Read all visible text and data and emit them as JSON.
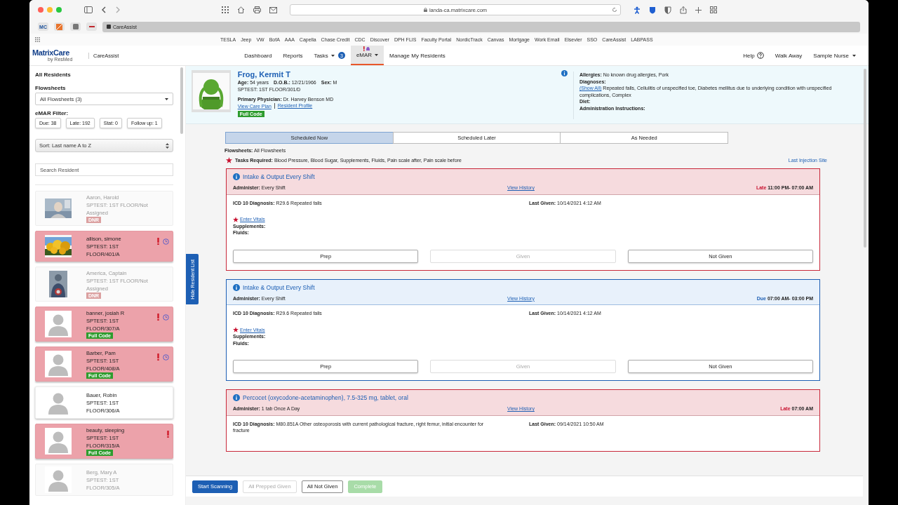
{
  "browser": {
    "url": "landa-ca.matrixcare.com",
    "pinned_tabs": [
      "MC"
    ],
    "tab_title": "CareAssist",
    "bookmarks": [
      "TESLA",
      "Jeep",
      "VW",
      "BofA",
      "AAA",
      "Capella",
      "Chase Credit",
      "CDC",
      "Discover",
      "DPH FLIS",
      "Faculty Portal",
      "NordicTrack",
      "Canvas",
      "Mortgage",
      "Work Email",
      "Elsevier",
      "SSO",
      "CareAssist",
      "LABPASS"
    ]
  },
  "app": {
    "brand": "MatrixCare",
    "brand_sub": "by ResMed",
    "product": "CareAssist",
    "nav": [
      {
        "label": "Dashboard",
        "selected": false,
        "dropdown": false,
        "alert": false
      },
      {
        "label": "Reports",
        "selected": false,
        "dropdown": false,
        "alert": false
      },
      {
        "label": "Tasks",
        "selected": false,
        "dropdown": true,
        "alert": false,
        "badge": "3"
      },
      {
        "label": "eMAR",
        "selected": true,
        "dropdown": true,
        "alert": true
      },
      {
        "label": "Manage My Residents",
        "selected": false,
        "dropdown": false,
        "alert": false
      }
    ],
    "help": "Help",
    "walk_away": "Walk Away",
    "user": "Sample Nurse"
  },
  "sidebar": {
    "title": "All Residents",
    "flowsheets_label": "Flowsheets",
    "flowsheets_value": "All Flowsheets (3)",
    "filter_label": "eMAR Filter:",
    "filters": [
      "Due: 38",
      "Late: 192",
      "Stat: 0",
      "Follow up: 1"
    ],
    "sort_value": "Sort: Last name A to Z",
    "search_placeholder": "Search Resident",
    "residents": [
      {
        "name": "Aaron, Harold",
        "location": "SPTEST: 1ST FLOOR/Not Assigned",
        "code": {
          "label": "DNR",
          "kind": "dnr"
        },
        "late": false,
        "dimmed": true,
        "avatar": {
          "kind": "portrait"
        },
        "alert": false,
        "clock": false
      },
      {
        "name": "allison, simone",
        "location": "SPTEST: 1ST FLOOR/401/A",
        "late": true,
        "dimmed": false,
        "avatar": {
          "kind": "flowers"
        },
        "alert": true,
        "clock": true
      },
      {
        "name": "America, Captain",
        "location": "SPTEST: 1ST FLOOR/Not Assigned",
        "code": {
          "label": "DNR",
          "kind": "dnr"
        },
        "late": false,
        "dimmed": true,
        "avatar": {
          "kind": "figure"
        },
        "alert": false,
        "clock": false
      },
      {
        "name": "banner, josiah R",
        "location": "SPTEST: 1ST FLOOR/307/A",
        "code": {
          "label": "Full Code",
          "kind": "full"
        },
        "late": true,
        "dimmed": false,
        "avatar": {
          "kind": "silhouette"
        },
        "alert": true,
        "clock": true
      },
      {
        "name": "Barber, Pam",
        "location": "SPTEST: 1ST FLOOR/408/A",
        "code": {
          "label": "Full Code",
          "kind": "full"
        },
        "late": true,
        "dimmed": false,
        "avatar": {
          "kind": "silhouette"
        },
        "alert": true,
        "clock": true
      },
      {
        "name": "Bauer, Robin",
        "location": "SPTEST: 1ST FLOOR/306/A",
        "late": false,
        "dimmed": false,
        "avatar": {
          "kind": "silhouette"
        },
        "alert": false,
        "clock": false
      },
      {
        "name": "beauty, sleeping",
        "location": "SPTEST: 1ST FLOOR/315/A",
        "code": {
          "label": "Full Code",
          "kind": "full"
        },
        "late": true,
        "dimmed": false,
        "avatar": {
          "kind": "silhouette"
        },
        "alert": true,
        "clock": false
      },
      {
        "name": "Berg, Mary A",
        "location": "SPTEST: 1ST FLOOR/305/A",
        "late": false,
        "dimmed": true,
        "avatar": {
          "kind": "silhouette"
        },
        "alert": false,
        "clock": false
      }
    ]
  },
  "hide_list": "Hide Resident List",
  "resident": {
    "name": "Frog, Kermit T",
    "demographics": [
      {
        "label": "Age:",
        "value": "54 years"
      },
      {
        "label": "D.O.B.:",
        "value": "12/21/1966"
      },
      {
        "label": "Sex:",
        "value": "M"
      }
    ],
    "location": "SPTEST: 1ST FLOOR/301/D",
    "physician": {
      "label": "Primary Physician:",
      "value": "Dr. Harvey Benson MD"
    },
    "care_plan": "View Care Plan",
    "profile": "Resident Profile",
    "code": "Full Code",
    "details": [
      {
        "label": "Allergies:",
        "value": "No known drug allergies, Pork"
      },
      {
        "label": "Diagnoses:"
      },
      {
        "link": "(Show All)",
        "value": "Repeated falls, Cellulitis of unspecified toe, Diabetes mellitus due to underlying condition with unspecified complications, Complex"
      },
      {
        "label": "Diet:"
      },
      {
        "label": "Administration Instructions:"
      }
    ]
  },
  "tabs": [
    {
      "label": "Scheduled Now",
      "selected": true
    },
    {
      "label": "Scheduled Later",
      "selected": false
    },
    {
      "label": "As Needed",
      "selected": false
    }
  ],
  "flowsheets": {
    "label": "Flowsheets:",
    "value": "All Flowsheets"
  },
  "tasks_required": {
    "label": "Tasks Required:",
    "value": "Blood Pressure, Blood Sugar, Supplements, Fluids, Pain scale after, Pain scale before"
  },
  "last_injection": "Last Injection Site",
  "cards": [
    {
      "late": true,
      "title": "Intake & Output Every Shift",
      "administer": {
        "label": "Administer:",
        "value": "Every Shift"
      },
      "history": "View History",
      "time_label": "Late",
      "time": "11:00 PM- 07:00 AM",
      "icd": {
        "label": "ICD 10 Diagnosis:",
        "value": "R29.6 Repeated falls"
      },
      "last_given": {
        "label": "Last Given:",
        "value": "10/14/2021 4:12 AM"
      },
      "vitals": "Enter Vitals",
      "extra_labels": [
        "Supplements:",
        "Fluids:"
      ],
      "buttons": [
        {
          "label": "Prep",
          "disabled": false
        },
        {
          "label": "Given",
          "disabled": true
        },
        {
          "label": "Not Given",
          "disabled": false
        }
      ]
    },
    {
      "late": false,
      "title": "Intake & Output Every Shift",
      "administer": {
        "label": "Administer:",
        "value": "Every Shift"
      },
      "history": "View History",
      "time_label": "Due",
      "time": "07:00 AM- 03:00 PM",
      "icd": {
        "label": "ICD 10 Diagnosis:",
        "value": "R29.6 Repeated falls"
      },
      "last_given": {
        "label": "Last Given:",
        "value": "10/14/2021 4:12 AM"
      },
      "vitals": "Enter Vitals",
      "extra_labels": [
        "Supplements:",
        "Fluids:"
      ],
      "buttons": [
        {
          "label": "Prep",
          "disabled": false
        },
        {
          "label": "Given",
          "disabled": true
        },
        {
          "label": "Not Given",
          "disabled": false
        }
      ]
    },
    {
      "late": true,
      "title": "Percocet (oxycodone-acetaminophen), 7.5-325 mg, tablet, oral",
      "administer": {
        "label": "Administer:",
        "value": "1 tab Once A Day"
      },
      "history": "View History",
      "time_label": "Late",
      "time": "07:00 AM",
      "icd": {
        "label": "ICD 10 Diagnosis:",
        "value": "M80.851A Other osteoporosis with current pathological fracture, right femur, initial encounter for fracture"
      },
      "last_given": {
        "label": "Last Given:",
        "value": "09/14/2021 10:50 AM"
      }
    }
  ],
  "action_bar": [
    {
      "label": "Start Scanning",
      "kind": "primary"
    },
    {
      "label": "All Prepped Given",
      "kind": "disabled"
    },
    {
      "label": "All Not Given",
      "kind": "outline"
    },
    {
      "label": "Complete",
      "kind": "success-disabled"
    }
  ]
}
